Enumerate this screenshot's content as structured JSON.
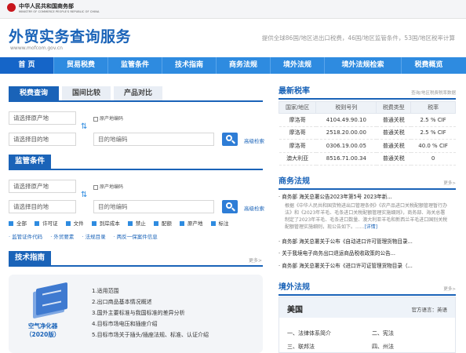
{
  "header": {
    "ministry_cn": "中华人民共和国商务部",
    "ministry_en": "MINISTRY OF COMMERCE PEOPLE'S REPUBLIC OF CHINA",
    "site_title": "外贸实务查询服务",
    "site_url": "wwww.mofcom.gov.cn",
    "tagline": "提供全球86国/地区进出口税费，46国/地区监管条件，53国/地区税率计算"
  },
  "nav": [
    "首 页",
    "贸易税费",
    "监管条件",
    "技术指南",
    "商务法规",
    "境外法规",
    "境外法规检索",
    "税费概览"
  ],
  "tax_query": {
    "tabs": [
      "税费查询",
      "国间比较",
      "产品对比"
    ],
    "origin_placeholder": "请选择原产地",
    "dest_placeholder": "请选择目的地",
    "origin_code_label": "原产地编码",
    "dest_code_placeholder": "目的地编码",
    "advanced_search": "高级检索"
  },
  "supervision": {
    "title": "监管条件",
    "origin_placeholder": "请选择原产地",
    "dest_placeholder": "请选择目的地",
    "origin_code_label": "原产地编码",
    "dest_code_placeholder": "目的地编码",
    "advanced_search": "高级检索",
    "filters": [
      "全部",
      "许可证",
      "文件",
      "到岸成本",
      "禁止",
      "配额",
      "原产地",
      "标注"
    ],
    "links": [
      "· 监管证件代码",
      "· 外贸要素",
      "· 法规目录",
      "· 两反一保案件信息"
    ]
  },
  "guide": {
    "title": "技术指南",
    "more": "更多>",
    "book_title_1": "空气净化器",
    "book_title_2": "（2020版）",
    "items": [
      "1.适用范围",
      "2.出口商品基本情况概述",
      "3.国外主要标准与我国标准的差异分析",
      "4.目标市场电压和插座介绍",
      "5.目标市场关于插头/插座法规、标准、认证介绍"
    ]
  },
  "rates": {
    "title": "最新税率",
    "subtitle": "查询/地区税费税率数据",
    "columns": [
      "国家/地区",
      "税则号列",
      "税费类型",
      "税率"
    ],
    "rows": [
      [
        "摩洛哥",
        "4104.49.90.10",
        "普通关税",
        "2.5 % CIF"
      ],
      [
        "摩洛哥",
        "2518.20.00.00",
        "普通关税",
        "2.5 % CIF"
      ],
      [
        "摩洛哥",
        "0306.19.00.05",
        "普通关税",
        "40.0 % CIF"
      ],
      [
        "澳大利亚",
        "8516.71.00.34",
        "普通关税",
        "0"
      ]
    ]
  },
  "commerce_law": {
    "title": "商务法规",
    "more": "更多>",
    "items": [
      "· 商务部 海关总署公告2023年第5号 2023年新...",
      "· 商务部 海关总署关于公布《自动进口许可管理货物目录...",
      "· 关于我境电子商务出口退运商品税收政策的公告...",
      "· 商务部 海关总署关于公布《进口许可证管理货物目录（..."
    ],
    "desc": "根据《中华人民共和国货物进出口管理条例》《农产品进口关税配额管理暂行办法》和《2023年羊毛、毛条进口关税配额管理实施细则》，商务部、海关总署制定了2023年羊毛、毛条进口数量、澳大利亚羊毛和新西兰羊毛进口国别关税配额管理实施细则，现公告如下。......",
    "desc_more": "[详情]"
  },
  "overseas_law": {
    "title": "境外法规",
    "more": "更多>",
    "country": "美国",
    "language": "官方语言：英语",
    "items": [
      "一、法律体系简介",
      "二、宪法",
      "三、联邦法",
      "四、州法"
    ]
  }
}
